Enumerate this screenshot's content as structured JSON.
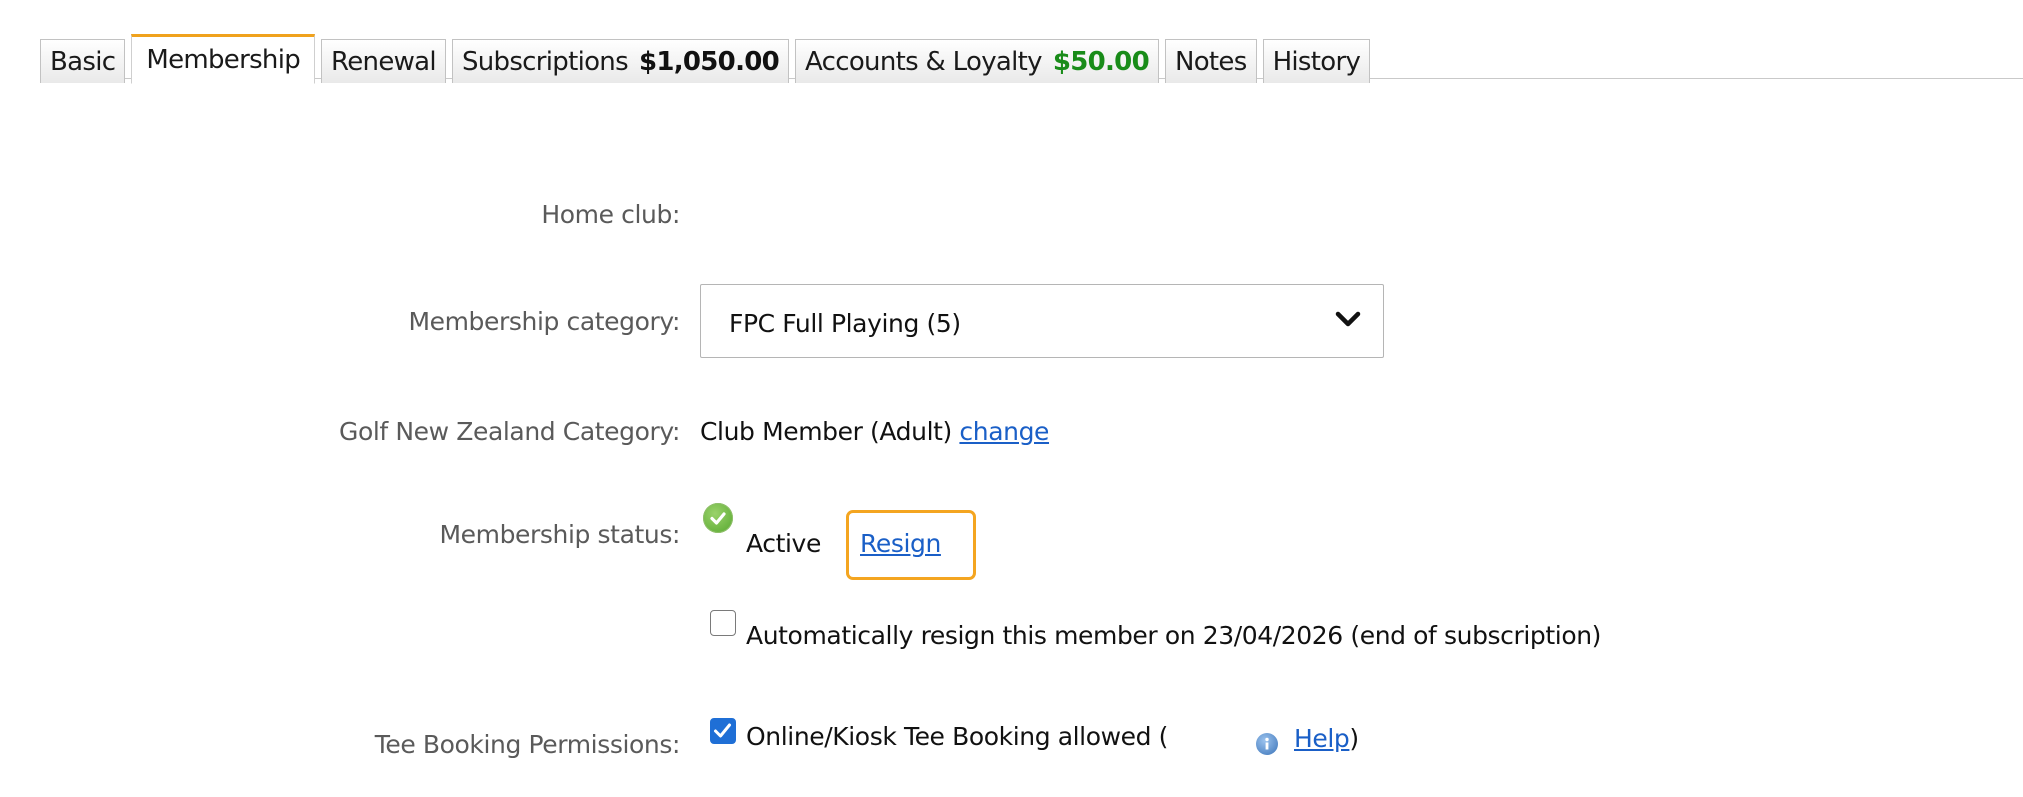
{
  "tabs": [
    {
      "label": "Basic",
      "amount": ""
    },
    {
      "label": "Membership",
      "amount": ""
    },
    {
      "label": "Renewal",
      "amount": ""
    },
    {
      "label": "Subscriptions",
      "amount": "$1,050.00"
    },
    {
      "label": "Accounts & Loyalty",
      "amount": "$50.00"
    },
    {
      "label": "Notes",
      "amount": ""
    },
    {
      "label": "History",
      "amount": ""
    }
  ],
  "active_tab": "Membership",
  "form": {
    "home_club": {
      "label": "Home club:",
      "value": ""
    },
    "membership_category": {
      "label": "Membership category:",
      "selected": "FPC Full Playing (5)"
    },
    "gnz_category": {
      "label": "Golf New Zealand Category:",
      "value": "Club Member (Adult)",
      "link": "change"
    },
    "membership_status": {
      "label": "Membership status:",
      "value": "Active",
      "link": "Resign",
      "auto_resign_text": "Automatically resign this member on 23/04/2026 (end of subscription)",
      "auto_resign_checked": false
    },
    "tee_booking": {
      "label": "Tee Booking Permissions:",
      "option_text": "Online/Kiosk Tee Booking allowed (",
      "checked": true,
      "help_link": "Help",
      "close_paren": ")"
    }
  },
  "icons": {
    "status": "check-circle-icon",
    "help": "info-icon",
    "dropdown": "chevron-down-icon"
  },
  "colors": {
    "active_tab_accent": "#f0a21d",
    "highlight": "#f4a520",
    "link": "#1a5fc7",
    "loyalty_amount": "#198c19"
  }
}
